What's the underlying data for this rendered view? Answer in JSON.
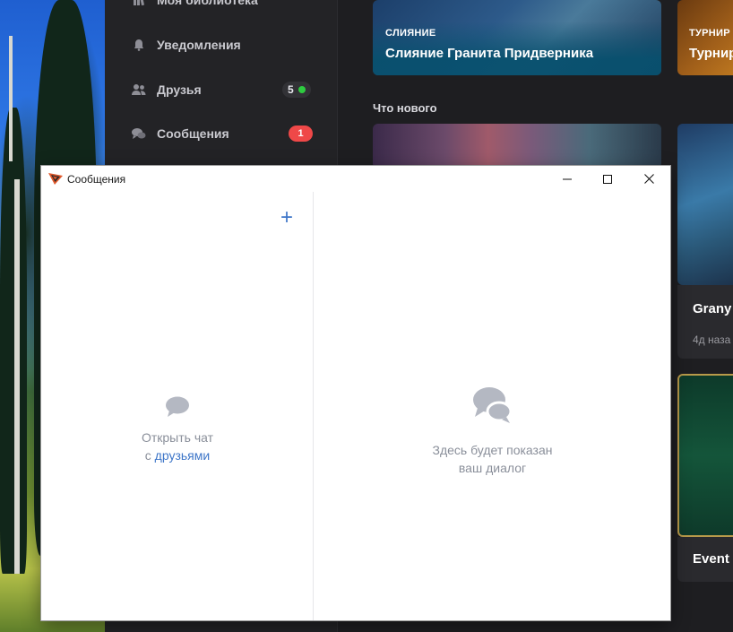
{
  "launcher": {
    "sidebar": {
      "items": [
        {
          "label": "Моя библиотека",
          "icon": "library-icon"
        },
        {
          "label": "Уведомления",
          "icon": "bell-icon"
        },
        {
          "label": "Друзья",
          "icon": "friends-icon",
          "badge": "5"
        },
        {
          "label": "Сообщения",
          "icon": "chat-icon",
          "badge": "1"
        }
      ]
    },
    "cards": [
      {
        "kicker": "СЛИЯНИЕ",
        "title": "Слияние Гранита Придверника"
      },
      {
        "kicker": "ТУРНИР",
        "title": "Турнир"
      }
    ],
    "section_title": "Что нового",
    "side_cards": [
      {
        "title": "Grany",
        "meta": "4д наза"
      },
      {
        "title": "Event"
      }
    ],
    "colors": {
      "badge_red": "#ef4848",
      "online_green": "#2ecc40",
      "panel": "#232326"
    }
  },
  "messages_window": {
    "title": "Сообщения",
    "controls": {
      "minimize": "—",
      "maximize": "☐",
      "close": "✕"
    },
    "left_pane": {
      "add_button": "+",
      "empty_line1": "Открыть чат",
      "empty_line2_prefix": "с ",
      "empty_link": "друзьями"
    },
    "right_pane": {
      "empty_line1": "Здесь будет показан",
      "empty_line2": "ваш диалог"
    },
    "colors": {
      "accent": "#3e76c8",
      "muted_text": "#8a8f9a",
      "icon_gray": "#b4b8c2"
    }
  }
}
